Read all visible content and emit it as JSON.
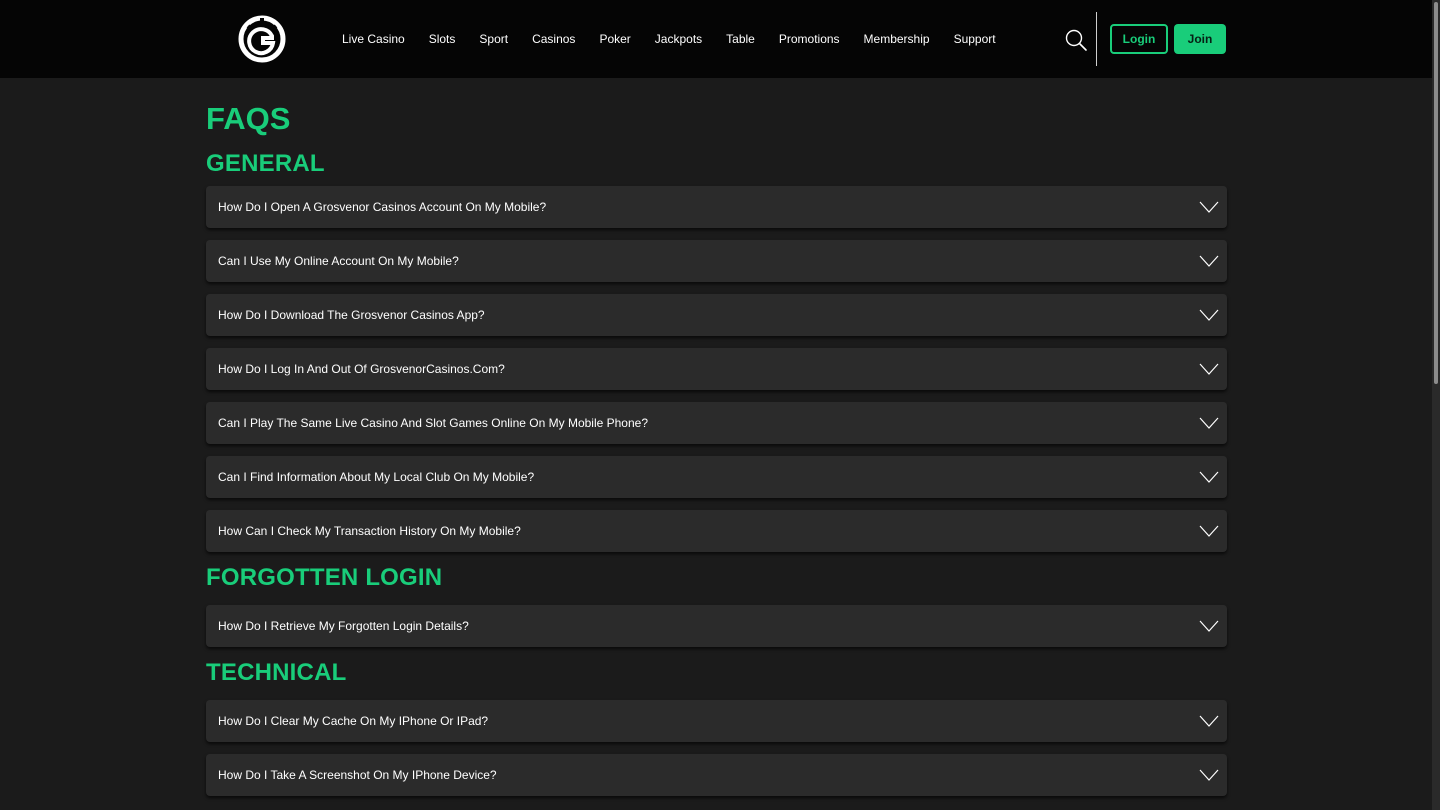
{
  "header": {
    "logo_icon": "grosvenor-g-logo-icon",
    "nav": [
      "Live Casino",
      "Slots",
      "Sport",
      "Casinos",
      "Poker",
      "Jackpots",
      "Table",
      "Promotions",
      "Membership",
      "Support"
    ],
    "search_icon": "search-icon",
    "login_label": "Login",
    "join_label": "Join"
  },
  "colors": {
    "accent": "#19cd7a",
    "header_bg": "#050505",
    "page_bg": "#1b1b1b",
    "card_bg": "#2b2b2b"
  },
  "page": {
    "title": "FAQS"
  },
  "sections": [
    {
      "title": "GENERAL",
      "questions": [
        "How Do I Open A Grosvenor Casinos Account On My Mobile?",
        "Can I Use My Online Account On My Mobile?",
        "How Do I Download The Grosvenor Casinos App?",
        "How Do I Log In And Out Of GrosvenorCasinos.Com?",
        "Can I Play The Same Live Casino And Slot Games Online On My Mobile Phone?",
        "Can I Find Information About My Local Club On My Mobile?",
        "How Can I Check My Transaction History On My Mobile?"
      ]
    },
    {
      "title": "FORGOTTEN LOGIN",
      "questions": [
        "How Do I Retrieve My Forgotten Login Details?"
      ]
    },
    {
      "title": "TECHNICAL",
      "questions": [
        "How Do I Clear My Cache On My IPhone Or IPad?",
        "How Do I Take A Screenshot On My IPhone Device?"
      ]
    }
  ],
  "faq_toggle_icon": "chevron-down-icon"
}
